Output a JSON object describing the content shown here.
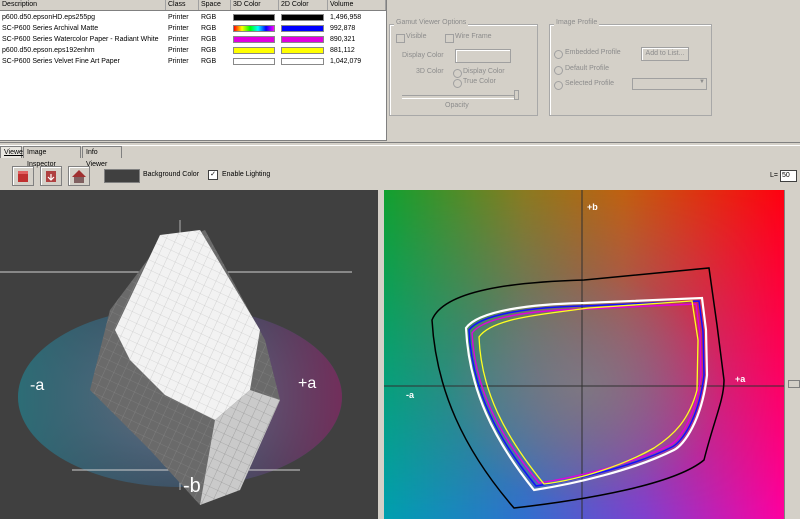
{
  "profile_table": {
    "headers": [
      "Description",
      "Class",
      "Space",
      "3D Color",
      "2D Color",
      "Volume"
    ],
    "rows": [
      {
        "description": "p600.d50.epsonHD.eps255pg",
        "class": "Printer",
        "space": "RGB",
        "color3d": "#000000",
        "color2d": "#000000",
        "volume": "1,496,958"
      },
      {
        "description": "SC-P600 Series Archival Matte",
        "class": "Printer",
        "space": "RGB",
        "color3d": "rainbow",
        "color2d": "#0000ff",
        "volume": "992,878"
      },
      {
        "description": "SC-P600 Series Watercolor Paper - Radiant White",
        "class": "Printer",
        "space": "RGB",
        "color3d": "#e000e0",
        "color2d": "#e000e0",
        "volume": "890,321"
      },
      {
        "description": "p600.d50.epson.eps192enhm",
        "class": "Printer",
        "space": "RGB",
        "color3d": "#ffff00",
        "color2d": "#ffff00",
        "volume": "881,112"
      },
      {
        "description": "SC-P600 Series Velvet Fine Art Paper",
        "class": "Printer",
        "space": "RGB",
        "color3d": "#ffffff",
        "color2d": "#ffffff",
        "volume": "1,042,079"
      }
    ]
  },
  "gamut_options": {
    "title": "Gamut Viewer Options",
    "visible_label": "Visible",
    "wire_frame_label": "Wire Frame",
    "display_color_label": "Display Color",
    "color_3d_label": "3D Color",
    "display_color_radio": "Display Color",
    "true_color_radio": "True Color",
    "opacity_label": "Opacity"
  },
  "image_profile": {
    "title": "Image Profile",
    "embedded_label": "Embedded Profile",
    "default_label": "Default Profile",
    "selected_label": "Selected Profile",
    "add_button": "Add to List..."
  },
  "tabs": [
    "Viewer",
    "Image Inspector",
    "Info Viewer"
  ],
  "toolbar": {
    "background_color_label": "Background Color",
    "background_color": "#404040",
    "lighting_label": "Enable Lighting",
    "lighting_checked": "✓"
  },
  "lightness": {
    "label": "L=",
    "value": "50"
  },
  "view3d": {
    "label_neg_a": "-a",
    "label_pos_a": "+a",
    "label_neg_b": "-b"
  },
  "view2d": {
    "label_pos_b": "+b",
    "label_neg_a": "-a",
    "label_pos_a": "+a"
  },
  "colors": {
    "panel_bg": "#d4d0c8",
    "view3d_bg": "#404040"
  }
}
